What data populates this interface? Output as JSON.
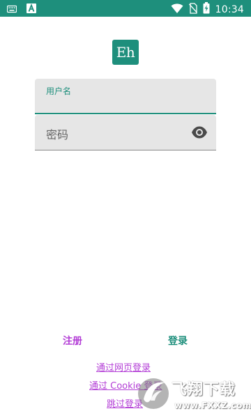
{
  "status_bar": {
    "time": "10:34",
    "icons": [
      "keyboard-icon",
      "app-a-icon",
      "wifi-icon",
      "no-sim-icon",
      "battery-charging-icon"
    ],
    "color": "#1e8f7c"
  },
  "app": {
    "logo_text": "Eh",
    "accent": "#1e8f7c",
    "link_color": "#b33ed6"
  },
  "form": {
    "username_label": "用户名",
    "password_placeholder": "密码"
  },
  "actions": {
    "register": "注册",
    "login": "登录",
    "login_web": "通过网页登录",
    "login_cookie": "通过 Cookie 登录",
    "skip_login": "跳过登录"
  },
  "watermark": {
    "title": "飞翔下载",
    "url": "www.FXXZ.com"
  }
}
